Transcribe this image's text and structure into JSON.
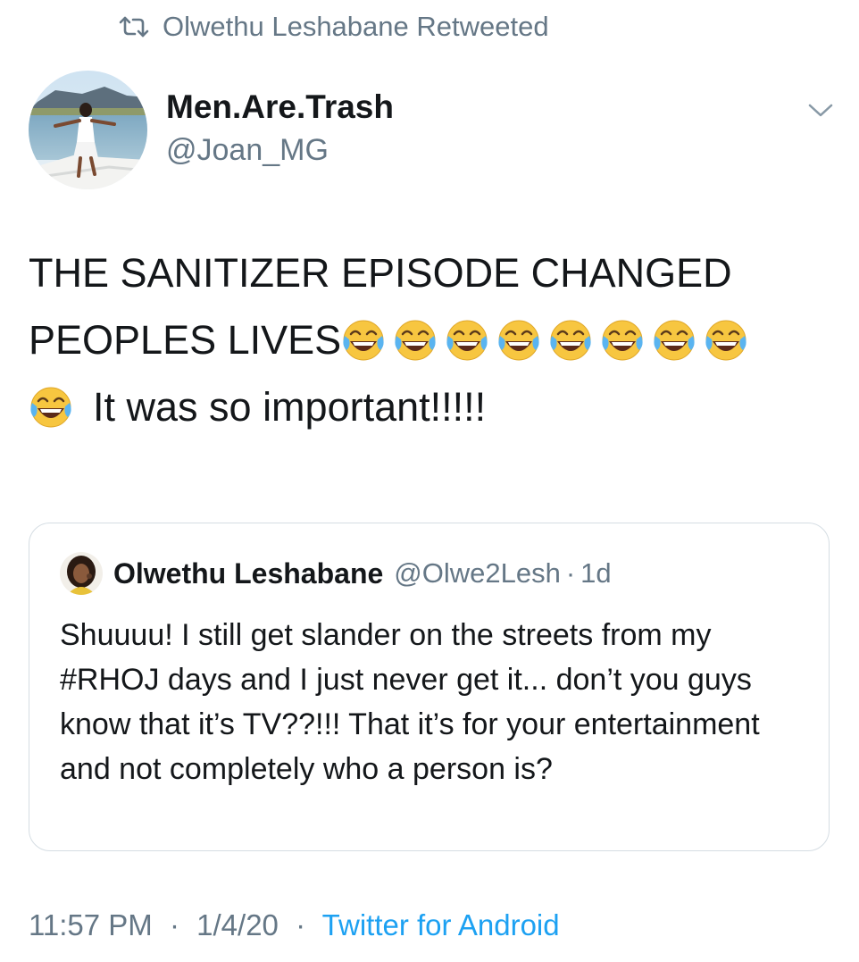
{
  "retweet_bar": {
    "icon": "retweet-icon",
    "label": "Olwethu Leshabane Retweeted"
  },
  "tweet": {
    "author": {
      "name": "Men.Are.Trash",
      "handle": "@Joan_MG",
      "avatar": "avatar-photo"
    },
    "menu_icon": "chevron-down-icon",
    "text_lines": [
      "THE SANITIZER EPISODE CHANGED",
      "PEOPLES LIVES",
      "It was so important!!!!!"
    ],
    "emoji_name": "face-with-tears-of-joy-emoji",
    "emoji_count_line2": 8,
    "emoji_count_line3": 1
  },
  "quoted_tweet": {
    "author_name": "Olwethu Leshabane",
    "handle": "@Olwe2Lesh",
    "separator": "·",
    "time": "1d",
    "text": "Shuuuu! I still get slander on the streets from my #RHOJ days and I just never get it... don’t you guys know that it’s TV??!!! That it’s for your entertainment and not completely who a person is?"
  },
  "meta": {
    "time": "11:57 PM",
    "date": "1/4/20",
    "source": "Twitter for Android",
    "separator": "·"
  },
  "colors": {
    "text_primary": "#14171a",
    "text_secondary": "#657786",
    "link": "#1da1f2",
    "border": "#d5dde3"
  }
}
